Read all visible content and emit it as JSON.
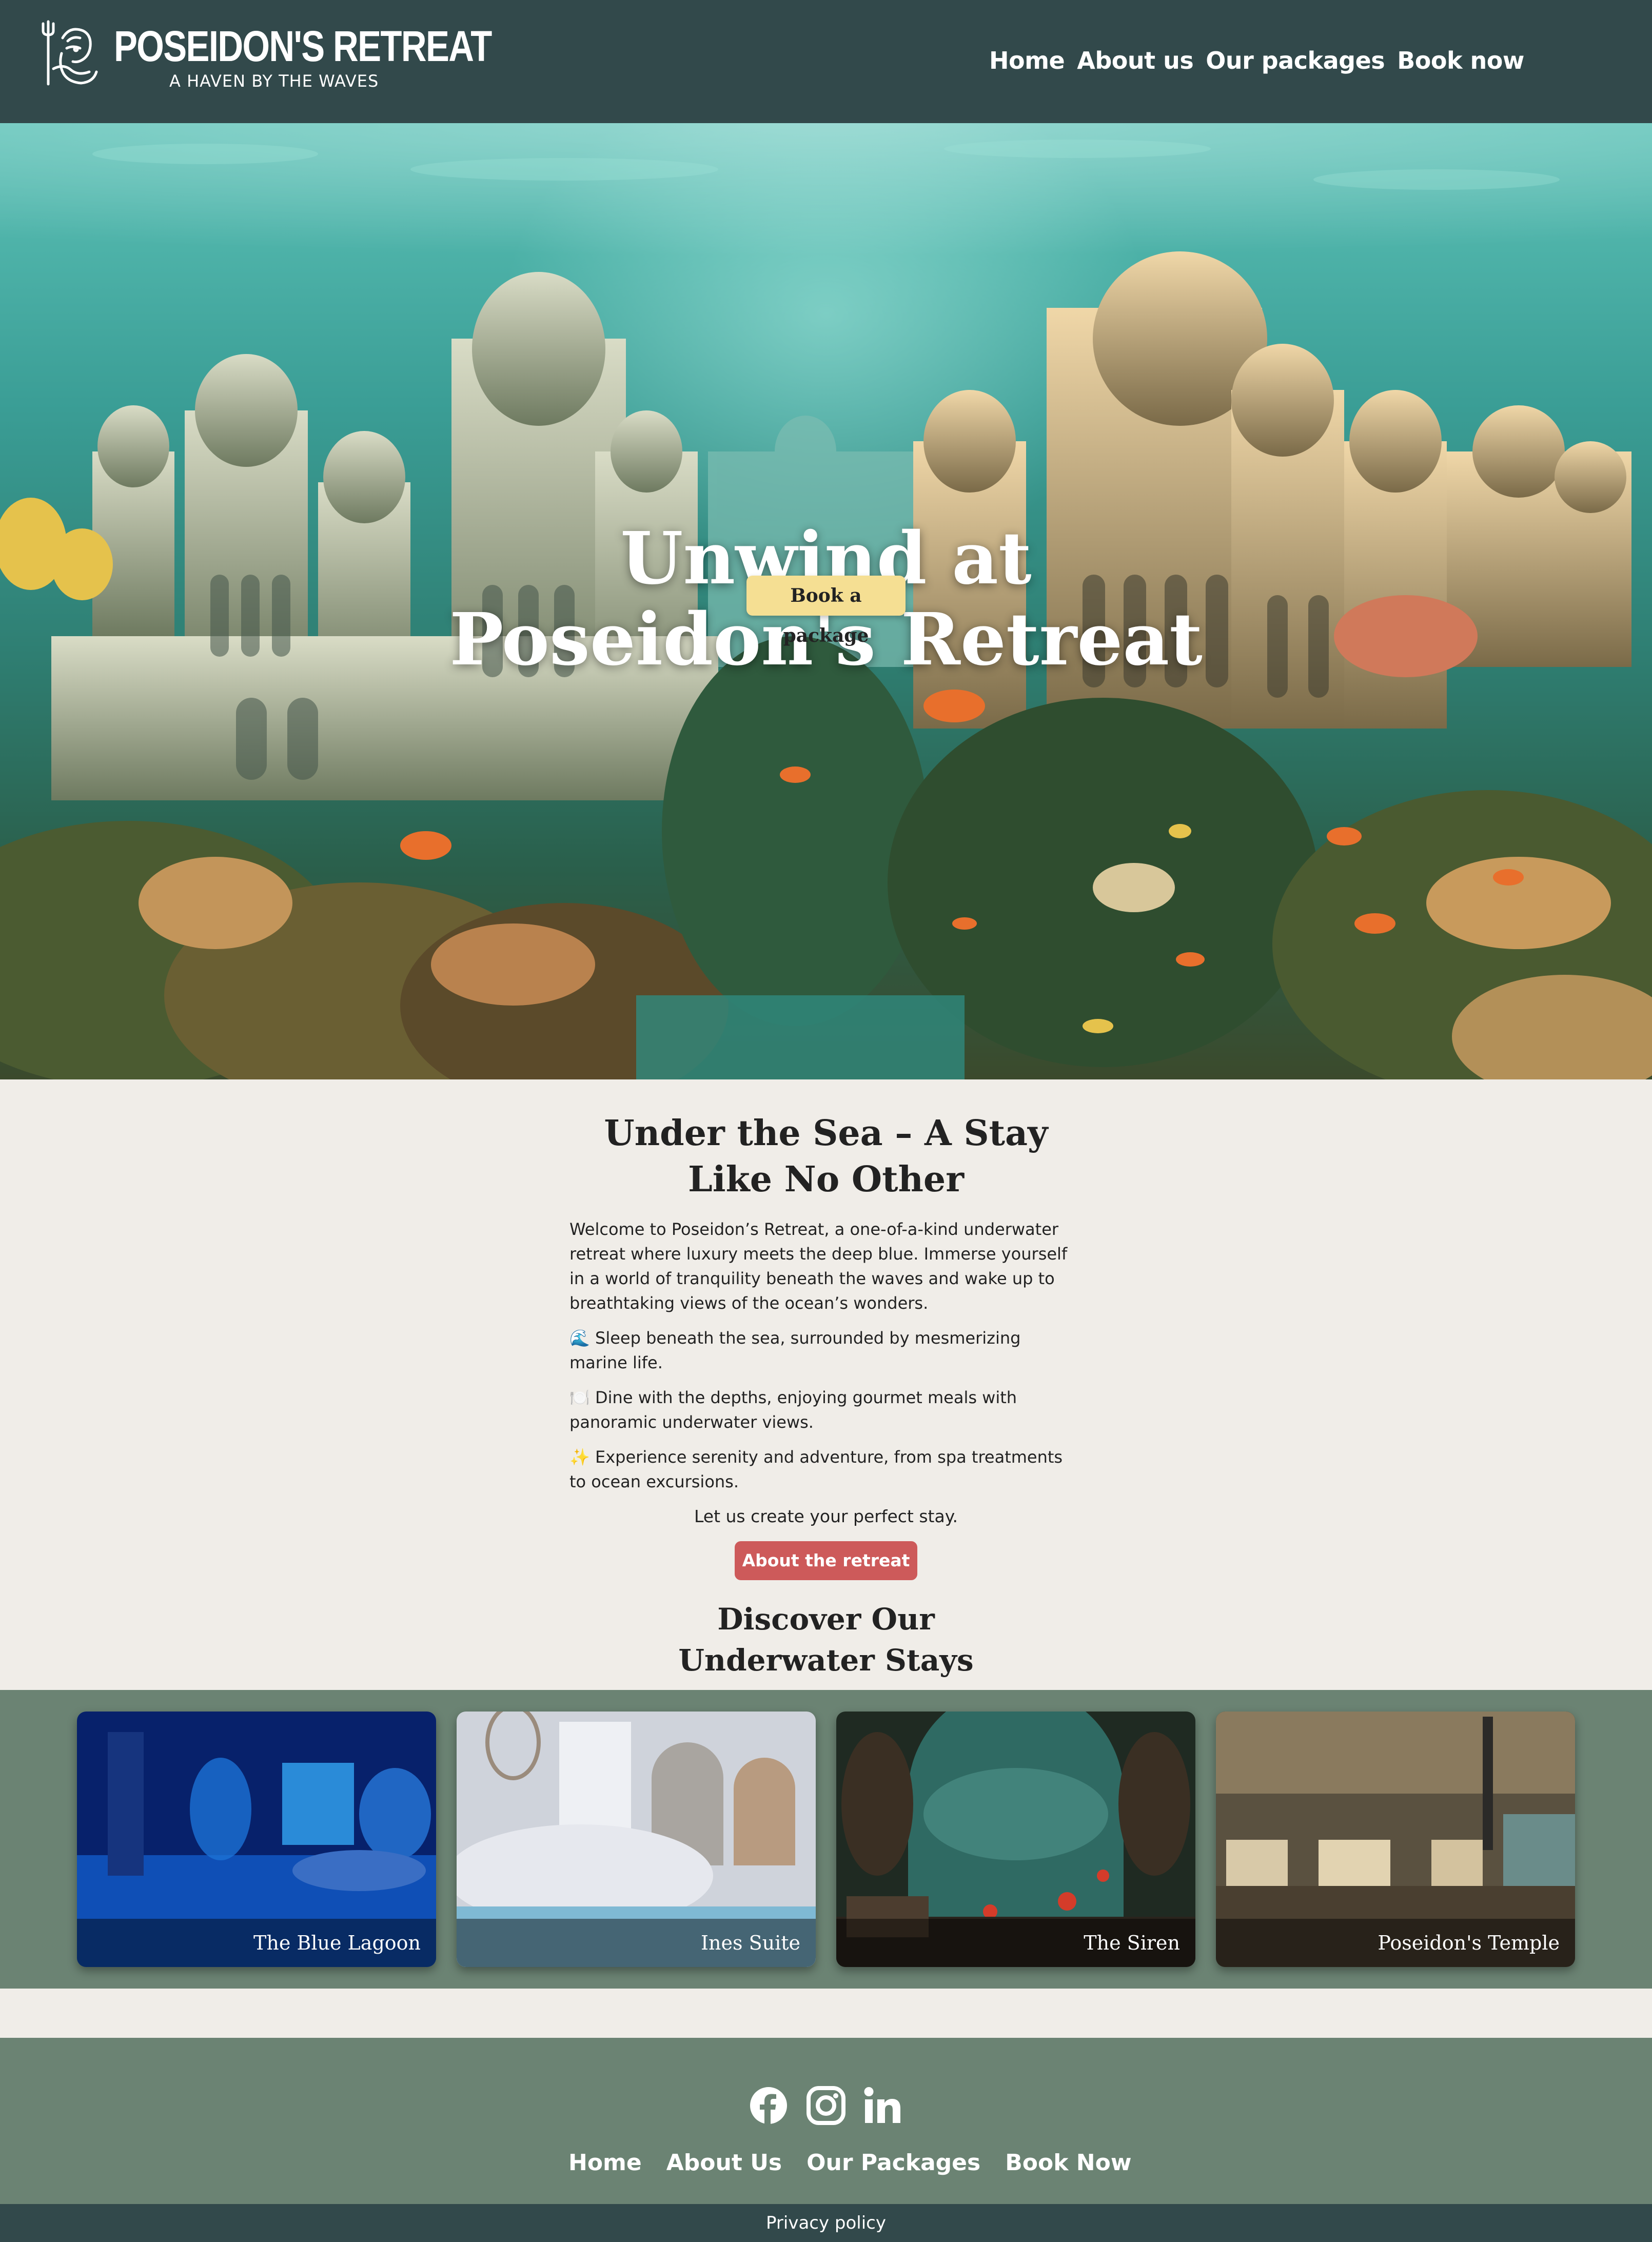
{
  "header": {
    "brand_title": "POSEIDON'S RETREAT",
    "brand_tagline": "A HAVEN BY THE WAVES",
    "logo_icon": "poseidon-trident-icon",
    "nav": [
      "Home",
      "About us",
      "Our packages",
      "Book now"
    ]
  },
  "hero": {
    "title_line1": "Unwind at",
    "title_line2": "Poseidon's Retreat",
    "cta_label": "Book a package"
  },
  "intro": {
    "title_line1": "Under the Sea – A Stay",
    "title_line2": "Like No Other",
    "paragraph": "Welcome to Poseidon’s Retreat, a one-of-a-kind underwater retreat where luxury meets the deep blue. Immerse yourself in a world of tranquility beneath the waves and wake up to breathtaking views of the ocean’s wonders.",
    "bullets": [
      {
        "icon": "🌊",
        "text": "Sleep beneath the sea, surrounded by mesmerizing marine life."
      },
      {
        "icon": "🍽️",
        "text": "Dine with the depths, enjoying gourmet meals with panoramic underwater views."
      },
      {
        "icon": "✨",
        "text": "Experience serenity and adventure, from spa treatments to ocean excursions."
      }
    ],
    "cta_text": "Let us create your perfect stay.",
    "about_button": "About the retreat"
  },
  "stays": {
    "title_line1": "Discover Our",
    "title_line2": "Underwater Stays",
    "cards": [
      {
        "label": "The Blue Lagoon"
      },
      {
        "label": "Ines Suite"
      },
      {
        "label": "The Siren"
      },
      {
        "label": "Poseidon's Temple"
      }
    ]
  },
  "footer": {
    "social_icons": [
      "facebook-icon",
      "instagram-icon",
      "linkedin-icon"
    ],
    "nav": [
      "Home",
      "About Us",
      "Our Packages",
      "Book Now"
    ],
    "privacy": "Privacy policy"
  },
  "colors": {
    "header_bg": "#32494b",
    "cream": "#f0ede8",
    "sage": "#6b8373",
    "book_button": "#f5df93",
    "about_button": "#cd5a5a"
  }
}
